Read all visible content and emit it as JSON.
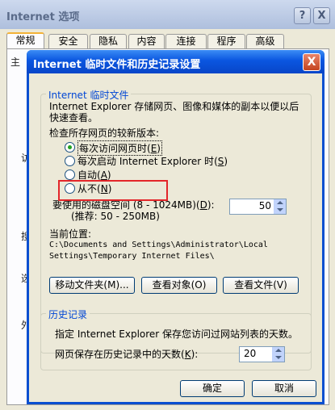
{
  "outer": {
    "title": "Internet 选项",
    "help_symbol": "?",
    "close_symbol": "X",
    "tabs": [
      "常规",
      "安全",
      "隐私",
      "内容",
      "连接",
      "程序",
      "高级"
    ],
    "peek_chars": [
      "主",
      "访",
      "搜",
      "选",
      "外"
    ]
  },
  "dialog": {
    "title": "Internet 临时文件和历史记录设置",
    "close_symbol": "X",
    "temp_group": {
      "label": "Internet 临时文件",
      "description_line1": "Internet Explorer 存储网页、图像和媒体的副本以便以后",
      "description_line2": "快速查看。",
      "check_label": "检查所存网页的较新版本:",
      "options": [
        {
          "text": "每次访问网页时",
          "key": "E",
          "selected": true
        },
        {
          "text": "每次启动 Internet Explorer 时",
          "key": "S",
          "selected": false
        },
        {
          "text": "自动",
          "key": "A",
          "selected": false
        },
        {
          "text": "从不",
          "key": "N",
          "selected": false
        }
      ],
      "disk_label": "要使用的磁盘空间 (8 - 1024MB)",
      "disk_key": "D",
      "disk_recommend": "(推荐: 50 - 250MB)",
      "disk_value": "50",
      "location_label": "当前位置:",
      "location_line1": "C:\\Documents and Settings\\Administrator\\Local",
      "location_line2": "Settings\\Temporary Internet Files\\",
      "buttons": {
        "move": "移动文件夹(M)...",
        "view_objects": "查看对象(O)",
        "view_files": "查看文件(V)"
      }
    },
    "history_group": {
      "label": "历史记录",
      "description": "指定 Internet Explorer 保存您访问过网站列表的天数。",
      "days_label": "网页保存在历史记录中的天数",
      "days_key": "K",
      "days_value": "20"
    },
    "ok_label": "确定",
    "cancel_label": "取消"
  },
  "colors": {
    "titlebar_blue": "#0a56e0",
    "highlight_red": "#e3262a",
    "group_label_blue": "#0046d5"
  }
}
